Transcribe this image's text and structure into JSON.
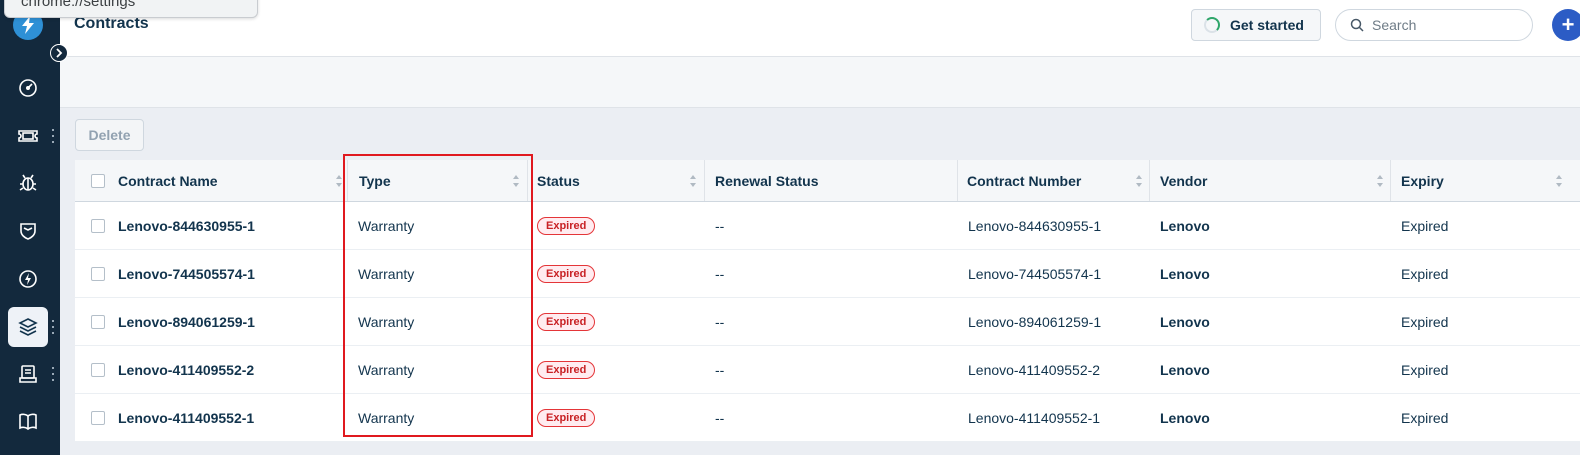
{
  "browser": {
    "url_tooltip": "chrome://settings"
  },
  "header": {
    "title": "Contracts",
    "get_started_label": "Get started",
    "search_placeholder": "Search",
    "plus_label": "+"
  },
  "sidebar": {
    "items": [
      {
        "icon": "gauge-icon",
        "has_menu": false
      },
      {
        "icon": "ticket-icon",
        "has_menu": true
      },
      {
        "icon": "bug-icon",
        "has_menu": false
      },
      {
        "icon": "shield-icon",
        "has_menu": false
      },
      {
        "icon": "lightning-icon",
        "has_menu": false
      },
      {
        "icon": "layers-icon",
        "has_menu": true,
        "active": true
      },
      {
        "icon": "inventory-icon",
        "has_menu": true
      },
      {
        "icon": "book-icon",
        "has_menu": false
      }
    ]
  },
  "toolbar": {
    "delete_label": "Delete"
  },
  "table": {
    "columns": [
      "Contract Name",
      "Type",
      "Status",
      "Renewal Status",
      "Contract Number",
      "Vendor",
      "Expiry"
    ],
    "rows": [
      {
        "name": "Lenovo-844630955-1",
        "type": "Warranty",
        "status": "Expired",
        "renewal": "--",
        "number": "Lenovo-844630955-1",
        "vendor": "Lenovo",
        "expiry": "Expired"
      },
      {
        "name": "Lenovo-744505574-1",
        "type": "Warranty",
        "status": "Expired",
        "renewal": "--",
        "number": "Lenovo-744505574-1",
        "vendor": "Lenovo",
        "expiry": "Expired"
      },
      {
        "name": "Lenovo-894061259-1",
        "type": "Warranty",
        "status": "Expired",
        "renewal": "--",
        "number": "Lenovo-894061259-1",
        "vendor": "Lenovo",
        "expiry": "Expired"
      },
      {
        "name": "Lenovo-411409552-2",
        "type": "Warranty",
        "status": "Expired",
        "renewal": "--",
        "number": "Lenovo-411409552-2",
        "vendor": "Lenovo",
        "expiry": "Expired"
      },
      {
        "name": "Lenovo-411409552-1",
        "type": "Warranty",
        "status": "Expired",
        "renewal": "--",
        "number": "Lenovo-411409552-1",
        "vendor": "Lenovo",
        "expiry": "Expired"
      }
    ]
  },
  "colors": {
    "sidebar_bg": "#13293d",
    "accent_blue": "#2c5cc5",
    "status_expired": "#c82124",
    "highlight": "#e0191f"
  }
}
